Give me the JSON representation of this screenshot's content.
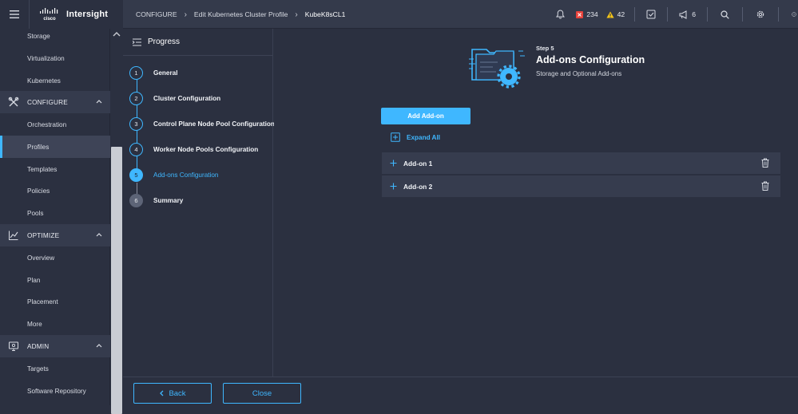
{
  "brand": {
    "logo_text": "cisco",
    "name": "Intersight"
  },
  "breadcrumb": [
    {
      "label": "CONFIGURE"
    },
    {
      "label": "Edit Kubernetes Cluster Profile"
    },
    {
      "label": "KubeK8sCL1"
    }
  ],
  "topbar": {
    "alerts_critical": "234",
    "alerts_warning": "42",
    "announcements": "6"
  },
  "sidebar": {
    "items_top": [
      "Storage",
      "Virtualization",
      "Kubernetes"
    ],
    "sections": [
      {
        "label": "CONFIGURE",
        "items": [
          "Orchestration",
          "Profiles",
          "Templates",
          "Policies",
          "Pools"
        ]
      },
      {
        "label": "OPTIMIZE",
        "items": [
          "Overview",
          "Plan",
          "Placement",
          "More"
        ]
      },
      {
        "label": "ADMIN",
        "items": [
          "Targets",
          "Software Repository"
        ]
      }
    ],
    "active": "Profiles"
  },
  "progress": {
    "title": "Progress",
    "steps": [
      {
        "num": "1",
        "label": "General"
      },
      {
        "num": "2",
        "label": "Cluster Configuration"
      },
      {
        "num": "3",
        "label": "Control Plane Node Pool Configuration"
      },
      {
        "num": "4",
        "label": "Worker Node Pools Configuration"
      },
      {
        "num": "5",
        "label": "Add-ons Configuration"
      },
      {
        "num": "6",
        "label": "Summary"
      }
    ]
  },
  "main": {
    "step_num": "Step 5",
    "title": "Add-ons Configuration",
    "subtitle": "Storage and Optional Add-ons",
    "add_button": "Add Add-on",
    "expand_all": "Expand All",
    "addons": [
      "Add-on 1",
      "Add-on 2"
    ]
  },
  "footer": {
    "back": "Back",
    "close": "Close"
  },
  "colors": {
    "accent": "#3fb7ff",
    "critical": "#e8423b",
    "warning": "#f5c518"
  }
}
